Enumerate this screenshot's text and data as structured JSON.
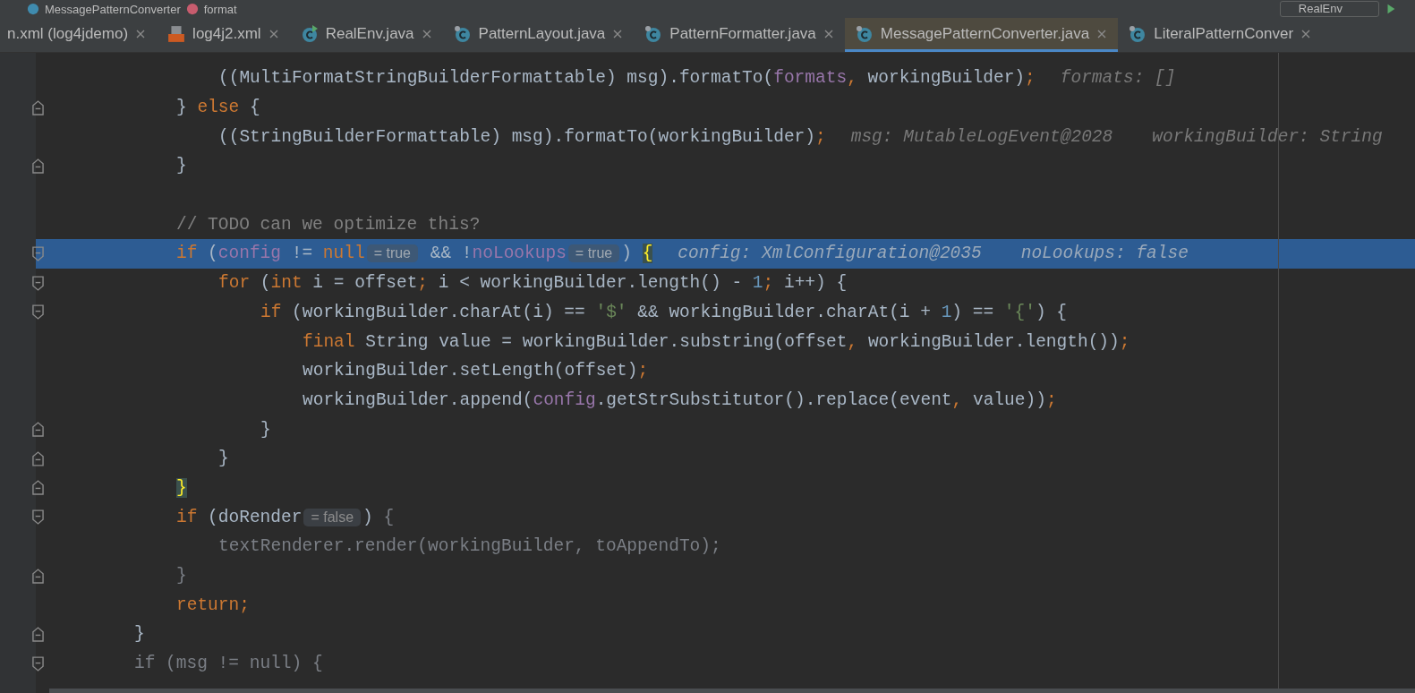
{
  "breadcrumbs": [
    {
      "text": "MessagePatternConverter"
    },
    {
      "text": "format"
    }
  ],
  "run_config": {
    "label": "RealEnv"
  },
  "tabs": [
    {
      "label": "n.xml (log4jdemo)",
      "kind": "plain",
      "selected": false
    },
    {
      "label": "log4j2.xml",
      "kind": "xml",
      "selected": false
    },
    {
      "label": "RealEnv.java",
      "kind": "runnable",
      "selected": false
    },
    {
      "label": "PatternLayout.java",
      "kind": "class",
      "selected": false
    },
    {
      "label": "PatternFormatter.java",
      "kind": "class",
      "selected": false
    },
    {
      "label": "MessagePatternConverter.java",
      "kind": "class",
      "selected": true
    },
    {
      "label": "LiteralPatternConver",
      "kind": "class",
      "selected": false
    }
  ],
  "lines": [
    {
      "kind": "group",
      "children": [
        {
          "kind": "group",
          "children": [
            {
              "kind": "plain",
              "selected": false,
              "segments": [
                {
                  "kind": "code",
                  "tokens": [
                    {
                      "kind": "plain",
                      "text": "((MultiFormatStringBuilderFormattable) msg).formatTo("
                    },
                    {
                      "kind": "var",
                      "text": "formats"
                    },
                    {
                      "kind": "kw",
                      "text": ", "
                    },
                    {
                      "kind": "plain",
                      "text": "workingBuilder)"
                    },
                    {
                      "kind": "kw",
                      "text": ";"
                    }
                  ]
                }
              ],
              "hints": [
                "formats: []"
              ]
            }
          ]
        },
        {
          "kind": "close",
          "selected": false,
          "segments": [
            {
              "kind": "code",
              "tokens": [
                {
                  "kind": "plain",
                  "text": "} "
                },
                {
                  "kind": "kw",
                  "text": "else"
                },
                {
                  "kind": "plain",
                  "text": " {"
                }
              ]
            }
          ],
          "children": [
            {
              "kind": "plain",
              "selected": false,
              "segments": [
                {
                  "kind": "code",
                  "tokens": [
                    {
                      "kind": "plain",
                      "text": "((StringBuilderFormattable) msg).formatTo(workingBuilder)"
                    },
                    {
                      "kind": "kw",
                      "text": ";"
                    }
                  ]
                }
              ],
              "hints": [
                "msg: MutableLogEvent@2028",
                "workingBuilder: String"
              ]
            }
          ]
        },
        {
          "kind": "close",
          "selected": false,
          "segments": [
            {
              "kind": "code",
              "tokens": [
                {
                  "kind": "plain",
                  "text": "}"
                }
              ]
            }
          ]
        },
        {
          "kind": "blank",
          "selected": false
        },
        {
          "kind": "plain",
          "selected": false,
          "segments": [
            {
              "kind": "code",
              "tokens": [
                {
                  "kind": "comment",
                  "text": "// TODO can we optimize this?"
                }
              ]
            }
          ]
        },
        {
          "kind": "open",
          "selected": true,
          "segments": [
            {
              "kind": "code",
              "tokens": [
                {
                  "kind": "kw",
                  "text": "if"
                },
                {
                  "kind": "plain",
                  "text": " ("
                },
                {
                  "kind": "var",
                  "text": "config"
                },
                {
                  "kind": "plain",
                  "text": " != "
                },
                {
                  "kind": "kw",
                  "text": "null"
                }
              ]
            },
            {
              "kind": "inlay",
              "text": "= true"
            },
            {
              "kind": "code",
              "tokens": [
                {
                  "kind": "plain",
                  "text": " && !"
                },
                {
                  "kind": "var",
                  "text": "noLookups"
                }
              ]
            },
            {
              "kind": "inlay",
              "text": "= true"
            },
            {
              "kind": "code",
              "tokens": [
                {
                  "kind": "plain",
                  "text": ") "
                },
                {
                  "kind": "brace",
                  "text": "{"
                }
              ]
            }
          ],
          "hints": [
            "config: XmlConfiguration@2035",
            "noLookups: false"
          ],
          "children": [
            {
              "kind": "open",
              "selected": false,
              "segments": [
                {
                  "kind": "code",
                  "tokens": [
                    {
                      "kind": "kw",
                      "text": "for"
                    },
                    {
                      "kind": "plain",
                      "text": " ("
                    },
                    {
                      "kind": "kw",
                      "text": "int"
                    },
                    {
                      "kind": "plain",
                      "text": " i = offset"
                    },
                    {
                      "kind": "kw",
                      "text": ";"
                    },
                    {
                      "kind": "plain",
                      "text": " i < workingBuilder.length() - "
                    },
                    {
                      "kind": "num",
                      "text": "1"
                    },
                    {
                      "kind": "kw",
                      "text": ";"
                    },
                    {
                      "kind": "plain",
                      "text": " i++) {"
                    }
                  ]
                }
              ],
              "children": [
                {
                  "kind": "open",
                  "selected": false,
                  "segments": [
                    {
                      "kind": "code",
                      "tokens": [
                        {
                          "kind": "kw",
                          "text": "if"
                        },
                        {
                          "kind": "plain",
                          "text": " (workingBuilder.charAt(i) == "
                        },
                        {
                          "kind": "str",
                          "text": "'$'"
                        },
                        {
                          "kind": "plain",
                          "text": " && workingBuilder.charAt(i + "
                        },
                        {
                          "kind": "num",
                          "text": "1"
                        },
                        {
                          "kind": "plain",
                          "text": ") == "
                        },
                        {
                          "kind": "str",
                          "text": "'{'"
                        },
                        {
                          "kind": "plain",
                          "text": ") {"
                        }
                      ]
                    }
                  ],
                  "children": [
                    {
                      "kind": "plain",
                      "selected": false,
                      "segments": [
                        {
                          "kind": "code",
                          "tokens": [
                            {
                              "kind": "kw",
                              "text": "final"
                            },
                            {
                              "kind": "plain",
                              "text": " String value = workingBuilder.substring(offset"
                            },
                            {
                              "kind": "kw",
                              "text": ", "
                            },
                            {
                              "kind": "plain",
                              "text": "workingBuilder.length())"
                            },
                            {
                              "kind": "kw",
                              "text": ";"
                            }
                          ]
                        }
                      ]
                    },
                    {
                      "kind": "plain",
                      "selected": false,
                      "segments": [
                        {
                          "kind": "code",
                          "tokens": [
                            {
                              "kind": "plain",
                              "text": "workingBuilder.setLength(offset)"
                            },
                            {
                              "kind": "kw",
                              "text": ";"
                            }
                          ]
                        }
                      ]
                    },
                    {
                      "kind": "plain",
                      "selected": false,
                      "segments": [
                        {
                          "kind": "code",
                          "tokens": [
                            {
                              "kind": "plain",
                              "text": "workingBuilder.append("
                            },
                            {
                              "kind": "var",
                              "text": "config"
                            },
                            {
                              "kind": "plain",
                              "text": ".getStrSubstitutor().replace(event"
                            },
                            {
                              "kind": "kw",
                              "text": ", "
                            },
                            {
                              "kind": "plain",
                              "text": "value))"
                            },
                            {
                              "kind": "kw",
                              "text": ";"
                            }
                          ]
                        }
                      ]
                    }
                  ]
                },
                {
                  "kind": "close",
                  "selected": false,
                  "segments": [
                    {
                      "kind": "code",
                      "tokens": [
                        {
                          "kind": "plain",
                          "text": "}"
                        }
                      ]
                    }
                  ]
                }
              ]
            },
            {
              "kind": "close",
              "selected": false,
              "segments": [
                {
                  "kind": "code",
                  "tokens": [
                    {
                      "kind": "plain",
                      "text": "}"
                    }
                  ]
                }
              ]
            }
          ]
        },
        {
          "kind": "close",
          "selected": false,
          "segments": [
            {
              "kind": "code",
              "tokens": [
                {
                  "kind": "brace",
                  "text": "}"
                }
              ]
            }
          ]
        },
        {
          "kind": "open",
          "selected": false,
          "segments": [
            {
              "kind": "code",
              "tokens": [
                {
                  "kind": "kw",
                  "text": "if"
                },
                {
                  "kind": "plain",
                  "text": " (doRender"
                }
              ]
            },
            {
              "kind": "inlay",
              "text": "= false"
            },
            {
              "kind": "code",
              "tokens": [
                {
                  "kind": "plain",
                  "text": ") "
                },
                {
                  "kind": "dim",
                  "text": "{"
                }
              ]
            }
          ],
          "children": [
            {
              "kind": "plain",
              "selected": false,
              "segments": [
                {
                  "kind": "code",
                  "tokens": [
                    {
                      "kind": "dim",
                      "text": "textRenderer.render(workingBuilder, toAppendTo);"
                    }
                  ]
                }
              ]
            }
          ]
        },
        {
          "kind": "close",
          "selected": false,
          "segments": [
            {
              "kind": "code",
              "tokens": [
                {
                  "kind": "dim",
                  "text": "}"
                }
              ]
            }
          ]
        },
        {
          "kind": "plain",
          "selected": false,
          "segments": [
            {
              "kind": "code",
              "tokens": [
                {
                  "kind": "kw",
                  "text": "return;"
                }
              ]
            }
          ]
        }
      ]
    },
    {
      "kind": "close",
      "selected": false,
      "segments": [
        {
          "kind": "code",
          "tokens": [
            {
              "kind": "plain",
              "text": "}"
            }
          ]
        }
      ]
    },
    {
      "kind": "open",
      "selected": false,
      "segments": [
        {
          "kind": "code",
          "tokens": [
            {
              "kind": "dim",
              "text": "if (msg != null) {"
            }
          ]
        }
      ]
    }
  ]
}
